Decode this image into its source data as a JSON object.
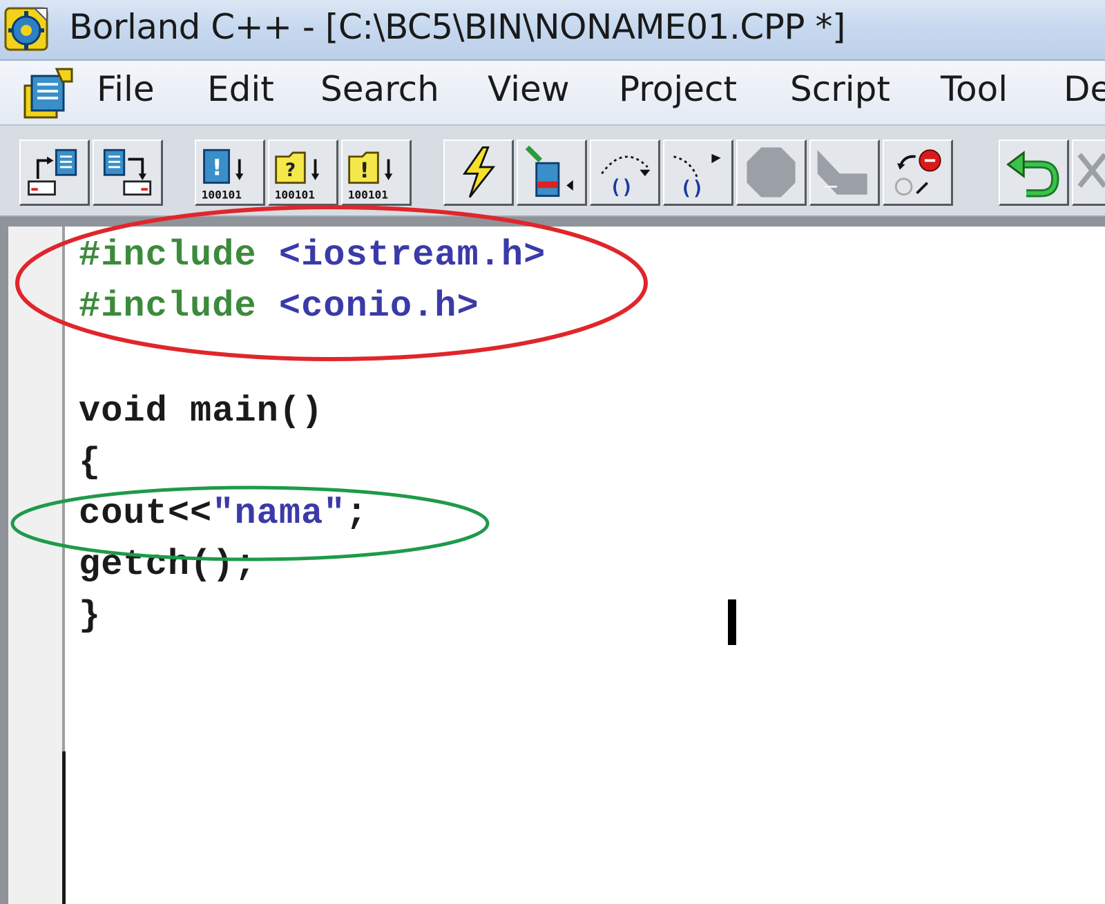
{
  "window": {
    "title": "Borland C++ - [C:\\BC5\\BIN\\NONAME01.CPP *]",
    "app_icon": "borland-gear-icon"
  },
  "menu": {
    "doc_icon": "document-icon",
    "items": [
      "File",
      "Edit",
      "Search",
      "View",
      "Project",
      "Script",
      "Tool",
      "De"
    ]
  },
  "toolbar": {
    "buttons": [
      "open-file-icon",
      "save-file-icon",
      "compile-icon",
      "make-icon",
      "build-all-icon",
      "run-icon",
      "debug-run-icon",
      "step-over-icon",
      "trace-into-icon",
      "stop-icon",
      "pause-icon",
      "breakpoint-icon",
      "undo-icon",
      "cut-icon"
    ]
  },
  "editor": {
    "lines": [
      {
        "directive": "#include",
        "header": "<iostream.h>"
      },
      {
        "directive": "#include",
        "header": "<conio.h>"
      },
      {
        "text": "void main()"
      },
      {
        "text": "{"
      },
      {
        "prefix": "cout<<",
        "string": "\"nama\"",
        "suffix": ";"
      },
      {
        "text": "getch();"
      },
      {
        "text": "}"
      }
    ]
  },
  "annotations": {
    "red_ellipse_color": "#e0262b",
    "green_ellipse_color": "#1e9a4a"
  }
}
